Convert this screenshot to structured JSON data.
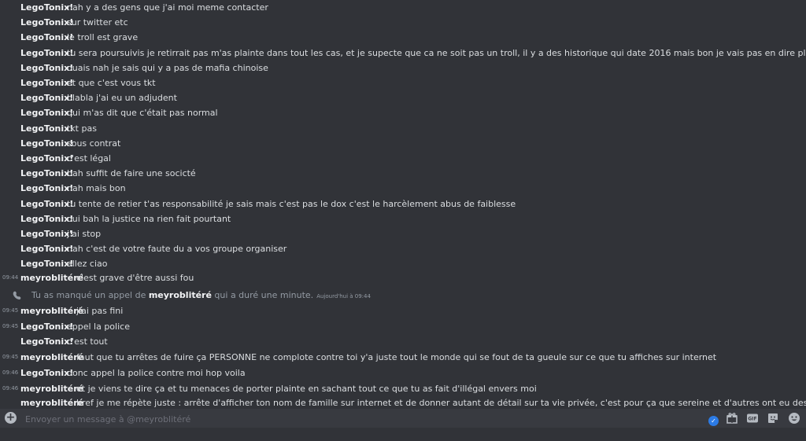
{
  "messages": [
    {
      "time": "",
      "author": "LegoTonix!",
      "text": "nah y a des gens que j'ai moi meme contacter"
    },
    {
      "time": "",
      "author": "LegoTonix!",
      "text": "sur twitter etc"
    },
    {
      "time": "",
      "author": "LegoTonix!",
      "text": "le troll est grave"
    },
    {
      "time": "",
      "author": "LegoTonix!",
      "text": "tu sera poursuivis je retirrait pas m'as plainte dans tout les cas, et je supecte que ca ne soit pas un troll, il y a des historique qui date 2016 mais bon je vais pas en dire plus"
    },
    {
      "time": "",
      "author": "LegoTonix!",
      "text": "ouais nah je sais qui y a pas de mafia chinoise"
    },
    {
      "time": "",
      "author": "LegoTonix!",
      "text": "et que c'est vous tkt"
    },
    {
      "time": "",
      "author": "LegoTonix!",
      "text": "blabla j'ai eu un adjudent"
    },
    {
      "time": "",
      "author": "LegoTonix!",
      "text": "qui m'as dit que c'était pas normal"
    },
    {
      "time": "",
      "author": "LegoTonix!",
      "text": "tkt pas"
    },
    {
      "time": "",
      "author": "LegoTonix!",
      "text": "sous contrat"
    },
    {
      "time": "",
      "author": "LegoTonix!",
      "text": "c'est légal"
    },
    {
      "time": "",
      "author": "LegoTonix!",
      "text": "bah suffit de faire une socicté"
    },
    {
      "time": "",
      "author": "LegoTonix!",
      "text": "nah mais bon"
    },
    {
      "time": "",
      "author": "LegoTonix!",
      "text": "tu tente de retier t'as responsabilité je sais mais c'est pas le dox c'est le harcèlement abus de faiblesse"
    },
    {
      "time": "",
      "author": "LegoTonix!",
      "text": "oui bah la justice na rien fait pourtant"
    },
    {
      "time": "",
      "author": "LegoTonix!",
      "text": "j'ai stop"
    },
    {
      "time": "",
      "author": "LegoTonix!",
      "text": "nah c'est de votre faute du a vos groupe organiser"
    },
    {
      "time": "",
      "author": "LegoTonix!",
      "text": "allez ciao"
    },
    {
      "time": "09:44",
      "author": "meyroblitéré",
      "text": "c'est grave d'être aussi fou"
    },
    {
      "time": "09:45",
      "author": "meyroblitéré",
      "text": "j'ai pas fini"
    },
    {
      "time": "09:45",
      "author": "LegoTonix!",
      "text": "appel la police"
    },
    {
      "time": "",
      "author": "LegoTonix!",
      "text": "c'est tout"
    },
    {
      "time": "09:45",
      "author": "meyroblitéré",
      "text": "faut que tu arrêtes de fuire ça PERSONNE ne complote contre toi y'a juste tout le monde qui se fout de ta gueule sur ce que tu affiches sur internet"
    },
    {
      "time": "09:46",
      "author": "LegoTonix!",
      "text": "donc appel la police contre moi hop voila"
    },
    {
      "time": "09:46",
      "author": "meyroblitéré",
      "text": "et je viens te dire ça et tu menaces de porter plainte en sachant tout ce que tu as fait d'illégal envers moi"
    },
    {
      "time": "",
      "author": "meyroblitéré",
      "text": "bref je me répète juste : arrête d'afficher ton nom de famille sur internet et de donner autant de détail sur ta vie privée, c'est pour ça que sereine et d'autres ont eu des infos sur ta"
    }
  ],
  "call_notice": {
    "prefix": "Tu as manqué un appel de ",
    "who": "meyroblitéré",
    "suffix": " qui a duré une minute.",
    "stamp": "Aujourd'hui à 09:44"
  },
  "composer": {
    "placeholder": "Envoyer un message à @meyroblitéré"
  }
}
